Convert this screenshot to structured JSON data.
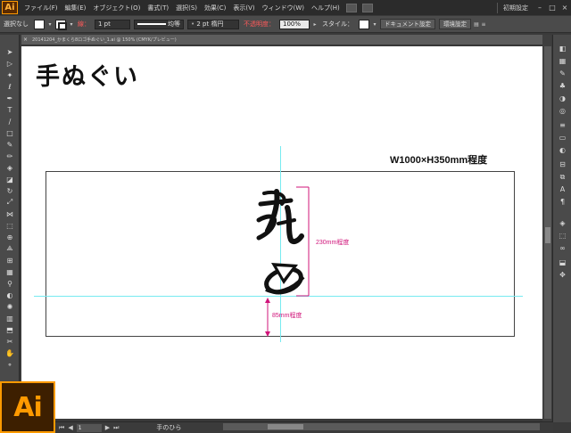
{
  "app": {
    "logo_text": "Ai"
  },
  "menu": {
    "items": [
      "ファイル(F)",
      "編集(E)",
      "オブジェクト(O)",
      "書式(T)",
      "選択(S)",
      "効果(C)",
      "表示(V)",
      "ウィンドウ(W)",
      "ヘルプ(H)"
    ],
    "workspace": "初期設定",
    "window_controls": [
      "–",
      "□",
      "×"
    ]
  },
  "control_bar": {
    "selection_status": "選択なし",
    "stroke_label": "線：",
    "stroke_weight": "1 pt",
    "profile_label": "均等",
    "brush_label": "2 pt 楕円",
    "opacity_label": "不透明度：",
    "opacity_value": "100%",
    "style_label": "スタイル：",
    "doc_settings_btn": "ドキュメント設定",
    "prefs_btn": "環境設定"
  },
  "document": {
    "tab_title": "20141204_かまくら8ロゴ手ぬぐい_1.ai @ 150% (CMYK/プレビュー)",
    "heading": "手ぬぐい",
    "size_label": "W1000×H350mm程度",
    "dimension_vertical": "230mm程度",
    "dimension_bottom": "85mm程度"
  },
  "status_bar": {
    "page": "1",
    "tool_name": "手のひら"
  },
  "colors": {
    "accent": "#ff9a00",
    "guide": "#77eaf0",
    "dimension": "#d0147a"
  },
  "tools": [
    "selection-icon",
    "direct-select-icon",
    "magic-wand-icon",
    "lasso-icon",
    "pen-icon",
    "type-icon",
    "line-icon",
    "rectangle-icon",
    "paintbrush-icon",
    "pencil-icon",
    "blob-brush-icon",
    "eraser-icon",
    "rotate-icon",
    "scale-icon",
    "width-icon",
    "free-transform-icon",
    "shape-builder-icon",
    "perspective-icon",
    "mesh-icon",
    "gradient-icon",
    "eyedropper-icon",
    "blend-icon",
    "symbol-sprayer-icon",
    "graph-icon",
    "artboard-icon",
    "slice-icon",
    "hand-icon",
    "zoom-icon"
  ],
  "right_panel_icons": [
    "color-icon",
    "swatches-icon",
    "brushes-icon",
    "symbols-icon",
    "graphic-styles-icon",
    "appearance-icon",
    "stroke-icon",
    "gradient-panel-icon",
    "transparency-icon",
    "align-icon",
    "pathfinder-icon",
    "character-icon",
    "paragraph-icon",
    "layers-icon",
    "artboards-icon",
    "links-icon",
    "transform-icon",
    "navigator-icon"
  ]
}
